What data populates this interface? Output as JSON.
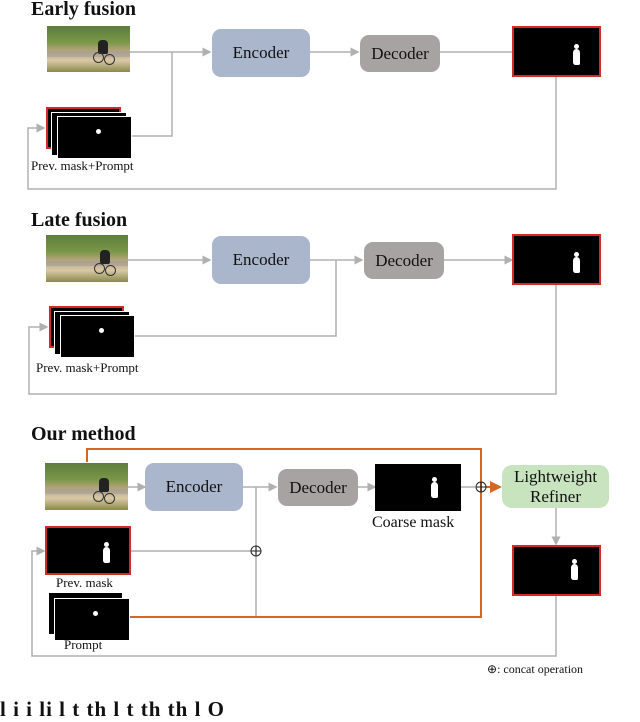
{
  "sections": {
    "early": {
      "title": "Early fusion",
      "encoder": "Encoder",
      "decoder": "Decoder",
      "input_label": "Prev. mask+Prompt"
    },
    "late": {
      "title": "Late fusion",
      "encoder": "Encoder",
      "decoder": "Decoder",
      "input_label": "Prev. mask+Prompt"
    },
    "ours": {
      "title": "Our method",
      "encoder": "Encoder",
      "decoder": "Decoder",
      "coarse_label": "Coarse mask",
      "refiner": "Lightweight Refiner",
      "prev_mask_label": "Prev. mask",
      "prompt_label": "Prompt"
    }
  },
  "legend": {
    "symbol": "⊕",
    "text": ": concat operation"
  },
  "colors": {
    "encoder": "#aab6cc",
    "decoder": "#a7a3a3",
    "refiner": "#c8e4bf",
    "orange_path": "#d2691e",
    "mask_border": "#d42a2a",
    "wire": "#b0b0b0"
  },
  "caption_fragment": "l     i   i   li     l  t      th    l  t    th    th  l    O"
}
